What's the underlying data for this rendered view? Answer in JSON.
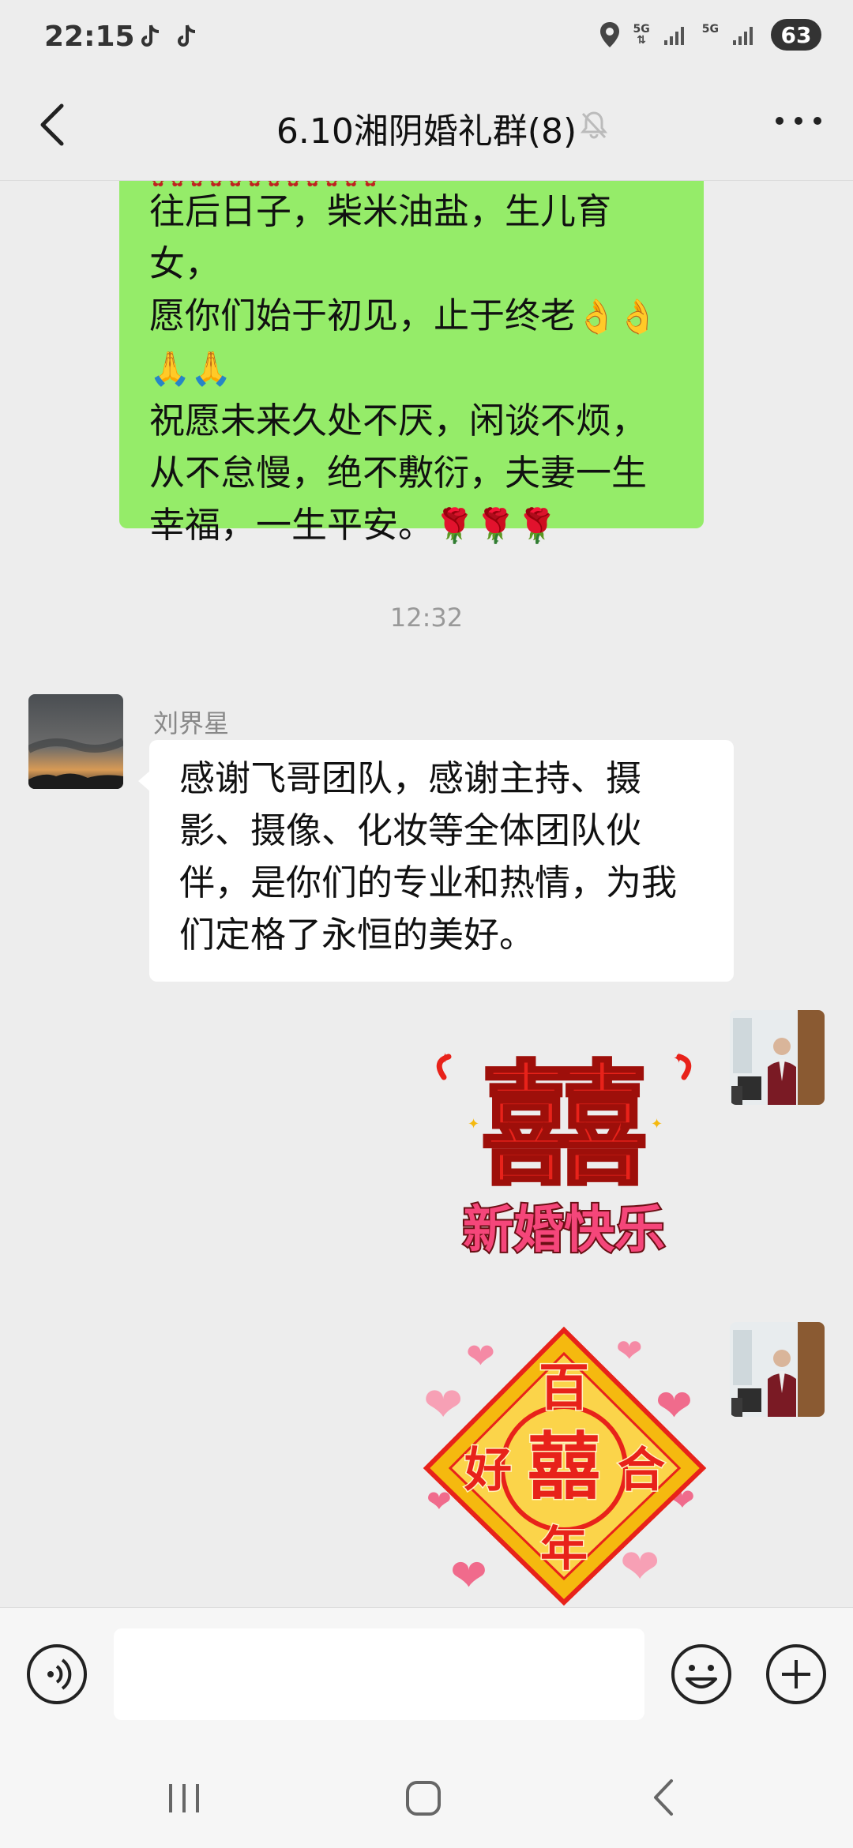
{
  "status": {
    "time": "22:15",
    "battery": "63",
    "net1": "5G",
    "net2": "5G"
  },
  "header": {
    "title": "6.10湘阴婚礼群(8)"
  },
  "messages": {
    "green": {
      "line1": "往后日子，柴米油盐，生儿育女，",
      "line2": "愿你们始于初见，止于终老",
      "line2_emoji": "👌👌",
      "line3_emoji": "🙏🙏",
      "line4": "祝愿未来久处不厌，闲谈不烦，",
      "line5": "从不怠慢，绝不敷衍，夫妻一生",
      "line6": "幸福，一生平安。",
      "line6_emoji": "🌹🌹🌹"
    },
    "timestamp": "12:32",
    "incoming": {
      "sender": "刘界星",
      "text": "感谢飞哥团队，感谢主持、摄影、摄像、化妆等全体团队伙伴，是你们的专业和热情，为我们定格了永恒的美好。"
    },
    "sticker1": {
      "big": "囍",
      "caption": "新婚快乐"
    },
    "sticker2": {
      "top": "百",
      "left": "好",
      "center": "囍",
      "right": "合",
      "bottom": "年"
    }
  },
  "input": {
    "placeholder": ""
  },
  "icons": {
    "back": "back-arrow-icon",
    "mute": "bell-off-icon",
    "more": "more-dots-icon",
    "voice": "voice-icon",
    "emoji": "emoji-icon",
    "plus": "plus-icon"
  },
  "colors": {
    "green_bubble": "#95ec69",
    "background": "#ededed",
    "sticker_red": "#e8221a",
    "sticker_gold": "#f5b90f"
  }
}
